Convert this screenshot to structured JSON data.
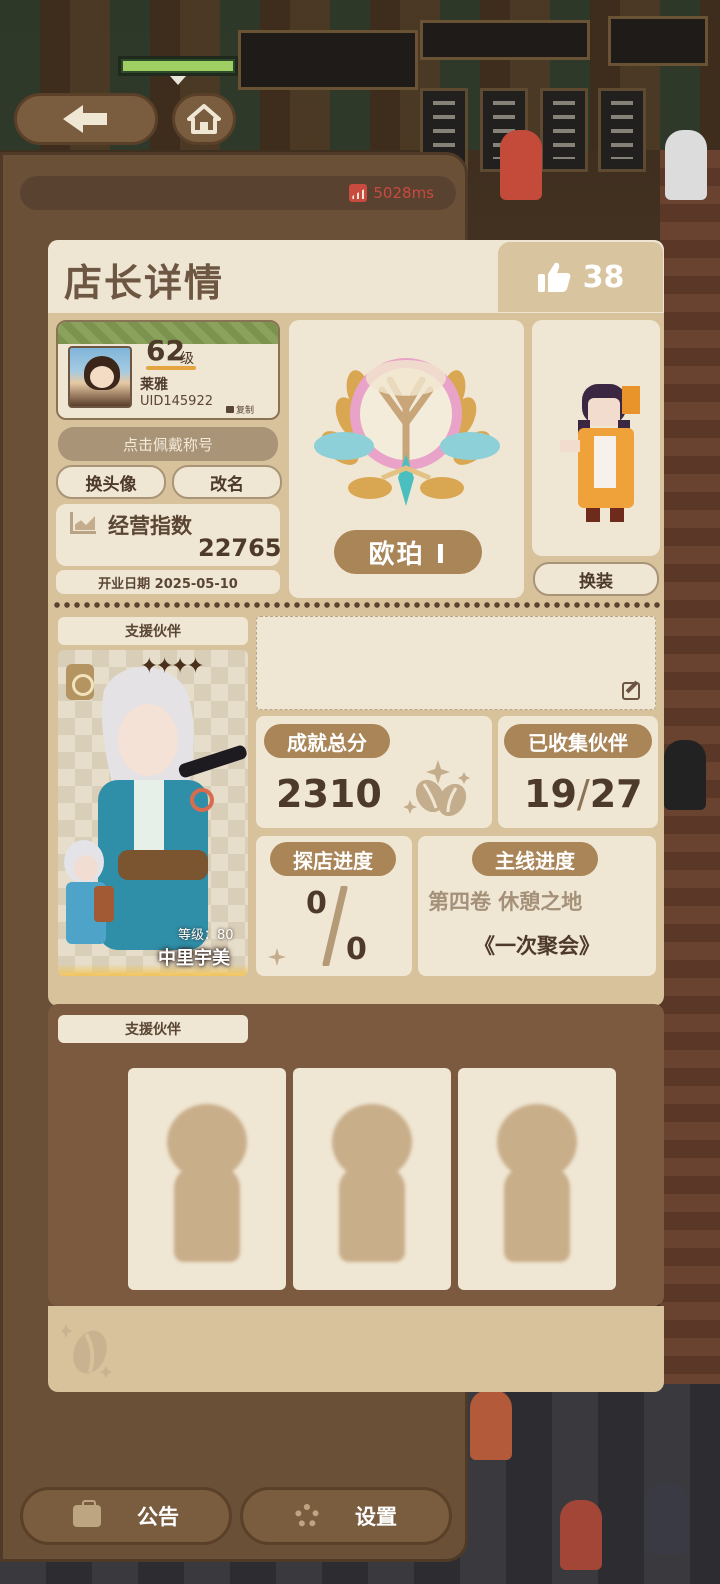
{
  "status": {
    "ping": "5028ms"
  },
  "nav": {
    "back_icon": "arrow-left-icon",
    "home_icon": "home-icon"
  },
  "header": {
    "title": "店长详情",
    "likes_icon": "thumbs-up-icon",
    "likes": "38"
  },
  "profile": {
    "level": "62",
    "level_suffix": "级",
    "name": "莱雅",
    "uid": "UID145922",
    "copy_label": "复制",
    "wear_title_label": "点击佩戴称号",
    "change_avatar_label": "换头像",
    "rename_label": "改名"
  },
  "business": {
    "label": "经营指数",
    "value": "22765",
    "open_date": "开业日期 2025-05-10"
  },
  "rank": {
    "name": "欧珀 I"
  },
  "outfit": {
    "button_label": "换装"
  },
  "support_partner": {
    "label": "支援伙伴",
    "stars": "✦✦✦✦",
    "level_text": "等级：80",
    "name": "中里宇美"
  },
  "stats": {
    "achievement_label": "成就总分",
    "achievement_value": "2310",
    "collected_label": "已收集伙伴",
    "collected_count": "19",
    "collected_total": "27",
    "visit_label": "探店进度",
    "visit_current": "0",
    "visit_total": "0",
    "mainline_label": "主线进度",
    "mainline_volume": "第四卷 休憩之地",
    "mainline_chapter": "《一次聚会》"
  },
  "support_slots": {
    "label": "支援伙伴"
  },
  "footer": {
    "notice_label": "公告",
    "settings_label": "设置"
  },
  "colors": {
    "accent": "#a98558",
    "panel": "#d7c29c",
    "card": "#efe6d3",
    "ping": "#c94a3e"
  }
}
